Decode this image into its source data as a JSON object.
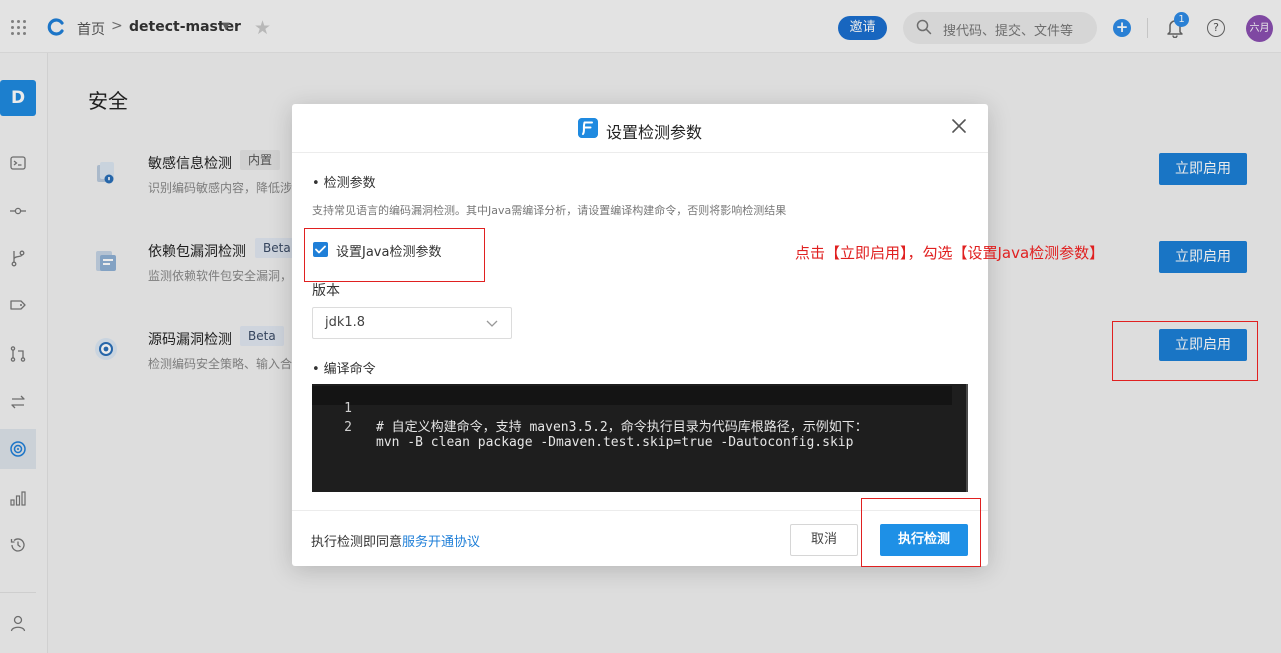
{
  "topbar": {
    "home_label": "首页",
    "breadcrumb_sep": ">",
    "repo_name": "detect-master",
    "invite_label": "邀请",
    "search_placeholder": "搜代码、提交、文件等",
    "notification_count": "1",
    "avatar_text": "六月",
    "icons": [
      "grid-icon",
      "logo-icon",
      "chevron-down-icon",
      "star-icon",
      "search-icon",
      "plus-icon",
      "bell-icon",
      "help-icon"
    ]
  },
  "sidebar": {
    "project_initial": "D",
    "items": [
      {
        "icon": "terminal-icon"
      },
      {
        "icon": "commit-icon"
      },
      {
        "icon": "branch-icon"
      },
      {
        "icon": "tag-icon"
      },
      {
        "icon": "merge-request-icon"
      },
      {
        "icon": "compare-icon"
      },
      {
        "icon": "security-scan-icon",
        "active": true
      },
      {
        "icon": "stats-icon"
      },
      {
        "icon": "history-icon"
      }
    ],
    "bottom_icon": "user-icon"
  },
  "main": {
    "title": "安全",
    "features": [
      {
        "name": "敏感信息检测",
        "badge": "内置",
        "desc": "识别编码敏感内容，降低涉",
        "button": "立即启用",
        "icon": "sensitive-info-icon"
      },
      {
        "name": "依赖包漏洞检测",
        "badge": "Beta",
        "desc": "监测依赖软件包安全漏洞，",
        "button": "立即启用",
        "icon": "dependency-icon"
      },
      {
        "name": "源码漏洞检测",
        "badge": "Beta",
        "desc": "检测编码安全策略、输入合",
        "button": "立即启用",
        "icon": "source-scan-icon"
      }
    ]
  },
  "modal": {
    "title": "设置检测参数",
    "section_params": "检测参数",
    "params_desc": "支持常见语言的编码漏洞检测。其中Java需编译分析，请设置编译构建命令，否则将影响检测结果",
    "java_checkbox_label": "设置Java检测参数",
    "java_checkbox_checked": true,
    "version_label": "版本",
    "version_value": "jdk1.8",
    "section_compile": "编译命令",
    "code_lines": [
      {
        "no": "1",
        "text": "# 自定义构建命令，支持 maven3.5.2，命令执行目录为代码库根路径，示例如下："
      },
      {
        "no": "2",
        "text": "mvn -B clean package -Dmaven.test.skip=true -Dautoconfig.skip"
      }
    ],
    "agree_prefix": "执行检测即同意",
    "agree_link": "服务开通协议",
    "cancel_label": "取消",
    "run_label": "执行检测"
  },
  "annotation": {
    "text": "点击【立即启用】，勾选【设置Java检测参数】",
    "color": "#e02020"
  },
  "colors": {
    "primary": "#1c7fd6",
    "avatar": "#8a4fb0"
  }
}
